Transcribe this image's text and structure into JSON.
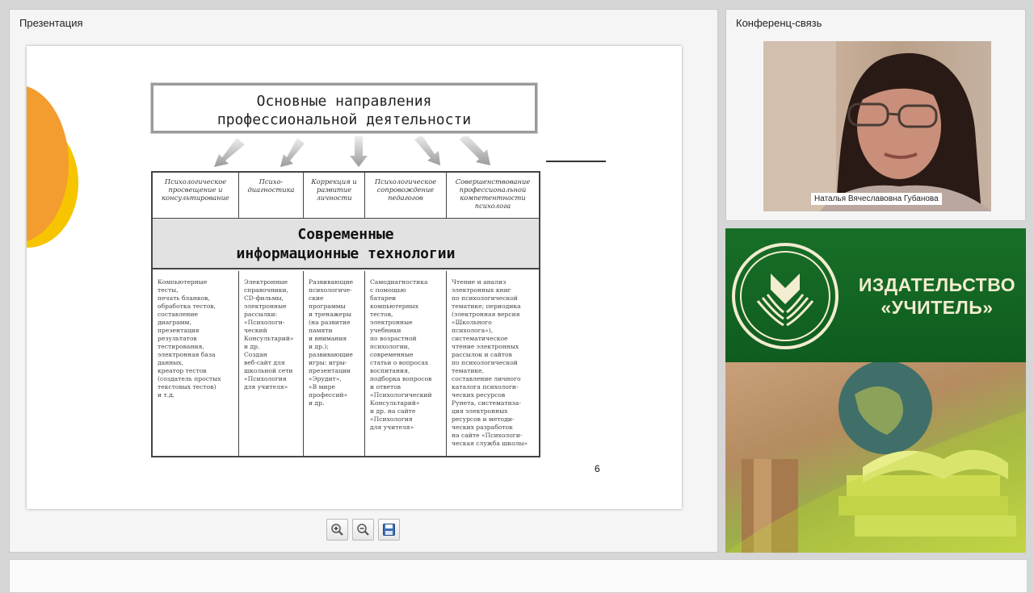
{
  "presentation": {
    "panel_title": "Презентация",
    "slide": {
      "title": "Основные направления\nпрофессиональной деятельности",
      "columns": [
        {
          "head": "Психологическое просвещение и консультирование",
          "body": "Компьютерные\nтесты,\nпечать бланков,\nобработка тестов,\nсоставление\nдиаграмм,\nпрезентация\nрезультатов\nтестирования,\nэлектронная база\nданных,\nкреатор тестов\n(создатель простых\nтекстовых тестов)\nи т.д."
        },
        {
          "head": "Психо-\nдиагностика",
          "body": "Электронные\nсправочники,\nCD-фильмы,\nэлектронные\nрассылки:\n«Психологи-\nческий\nКонсультарий»\nи др.\nСоздан\nвеб-сайт для\nшкольной сети\n«Психология\nдля учителя»"
        },
        {
          "head": "Коррекция и развитие личности",
          "body": "Развивающие\nпсихологиче-\nские\nпрограммы\nи тренажеры\n(на развитие\nпамяти\nи внимания\nи др.);\nразвивающие\nигры: игры-\nпрезентации\n«Эрудит»,\n«В мире\nпрофессий»\nи др."
        },
        {
          "head": "Психологическое сопровождение педагогов",
          "body": "Самодиагностика\nс помощью\nбатареи\nкомпьютерных\nтестов,\nэлектронные\nучебники\nпо возрастной\nпсихологии,\nсовременные\nстатьи о вопросах\nвоспитания,\nподборка вопросов\nи ответов\n«Психологический\nКонсультарий»\nи др. на сайте\n«Психология\nдля учителя»"
        },
        {
          "head": "Совершенствование профессиональной компетентности психолога",
          "body": "Чтение и анализ\nэлектронных книг\nпо психологической\nтематике; периодика\n(электронная версия\n«Школьного\nпсихолога»),\nсистематическое\nчтение электронных\nрассылок и сайтов\nпо психологической\nтематике,\nсоставление личного\nкаталога психологи-\nческих ресурсов\nРунета, систематиза-\nция электронных\nресурсов и методи-\nческих разработок\nна сайте «Психологи-\nческая служба школы»"
        }
      ],
      "banner": "Современные\nинформационные  технологии",
      "page_number": "6"
    },
    "toolbar": [
      "zoom-in-icon",
      "zoom-out-icon",
      "save-icon"
    ]
  },
  "conference": {
    "panel_title": "Конференц-связь",
    "speaker_name": "Наталья Вячеславовна Губанова"
  },
  "publisher": {
    "name": "ИЗДАТЕЛЬСТВО\n«УЧИТЕЛЬ»",
    "colors": {
      "green": "#186f27",
      "logo_cream": "#f2ecd0"
    }
  }
}
